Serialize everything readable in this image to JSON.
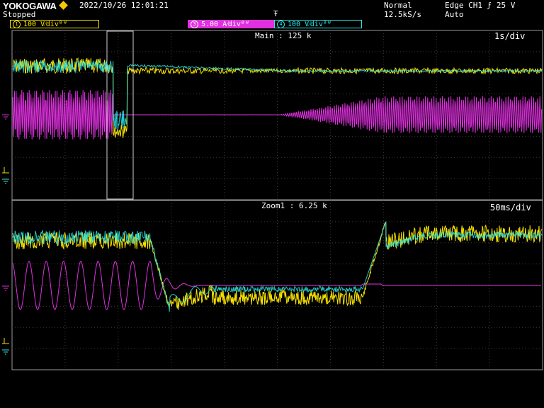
{
  "header": {
    "brand": "YOKOGAWA",
    "datetime": "2022/10/26  12:01:21",
    "status": "Stopped",
    "acq_mode": "Normal",
    "sample_rate": "12.5kS/s",
    "trigger_type": "Edge CH1  ϝ  25 V",
    "trigger_mode": "Auto",
    "trigger_marker": "Ŧ"
  },
  "channels": [
    {
      "id": "1",
      "label": "100  V⁄div",
      "suffix": "ᴮᵂ",
      "color": "#f5e000"
    },
    {
      "id": "3",
      "label": "5.00  A⁄div",
      "suffix": "ᴮᵂ",
      "color": "#e030e0"
    },
    {
      "id": "4",
      "label": "100  V⁄div",
      "suffix": "ᴮᵂ",
      "color": "#2ee6e6"
    }
  ],
  "main_panel": {
    "title": "Main : 125 k",
    "timebase": "1s/div"
  },
  "zoom_panel": {
    "title": "Zoom1 : 6.25 k",
    "timebase": "50ms/div"
  },
  "colors": {
    "ch1": "#f5e000",
    "ch3": "#e030e0",
    "ch4": "#2ee6e6",
    "grid": "#3a3a3a",
    "frame": "#9a9a9a"
  }
}
